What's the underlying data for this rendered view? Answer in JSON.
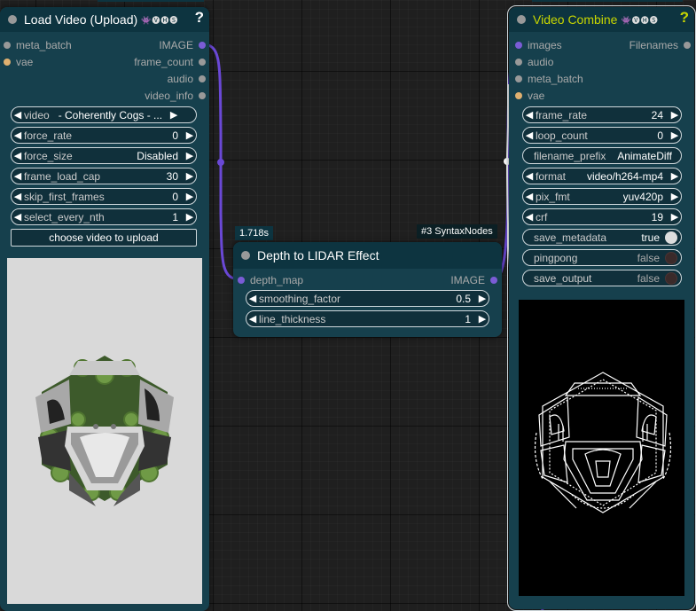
{
  "load_video": {
    "title": "Load Video (Upload)",
    "badge": "👾🅥🅗🅢",
    "help": "?",
    "inputs": [
      {
        "name": "meta_batch",
        "connected": false
      },
      {
        "name": "vae",
        "connected": false
      }
    ],
    "outputs": [
      "IMAGE",
      "frame_count",
      "audio",
      "video_info"
    ],
    "widgets": [
      {
        "label": "video",
        "value": "- Coherently Cogs - ..."
      },
      {
        "label": "force_rate",
        "value": "0"
      },
      {
        "label": "force_size",
        "value": "Disabled"
      },
      {
        "label": "frame_load_cap",
        "value": "30"
      },
      {
        "label": "skip_first_frames",
        "value": "0"
      },
      {
        "label": "select_every_nth",
        "value": "1"
      }
    ],
    "upload_label": "choose video to upload",
    "preview": "gear-cube-render"
  },
  "lidar": {
    "timing": "1.718s",
    "node_id": "#3 SyntaxNodes",
    "title": "Depth to LIDAR Effect",
    "input": "depth_map",
    "output": "IMAGE",
    "widgets": [
      {
        "label": "smoothing_factor",
        "value": "0.5"
      },
      {
        "label": "line_thickness",
        "value": "1"
      }
    ]
  },
  "video_combine": {
    "title": "Video Combine",
    "badge": "👾🅥🅗🅢",
    "help": "?",
    "inputs": [
      "images",
      "audio",
      "meta_batch",
      "vae"
    ],
    "output": "Filenames",
    "widgets": [
      {
        "kind": "combo",
        "label": "frame_rate",
        "value": "24"
      },
      {
        "kind": "combo",
        "label": "loop_count",
        "value": "0"
      },
      {
        "kind": "text",
        "label": "filename_prefix",
        "value": "AnimateDiff"
      },
      {
        "kind": "combo",
        "label": "format",
        "value": "video/h264-mp4"
      },
      {
        "kind": "combo",
        "label": "pix_fmt",
        "value": "yuv420p"
      },
      {
        "kind": "combo",
        "label": "crf",
        "value": "19"
      },
      {
        "kind": "toggle",
        "label": "save_metadata",
        "value": "true"
      },
      {
        "kind": "toggle",
        "label": "pingpong",
        "value": "false"
      },
      {
        "kind": "toggle",
        "label": "save_output",
        "value": "false"
      }
    ],
    "preview": "lidar-line-render"
  },
  "colors": {
    "node_body": "#16404d",
    "node_title": "#0d3440",
    "link": "#6a48d6",
    "accent_yellow": "#c8d600"
  }
}
